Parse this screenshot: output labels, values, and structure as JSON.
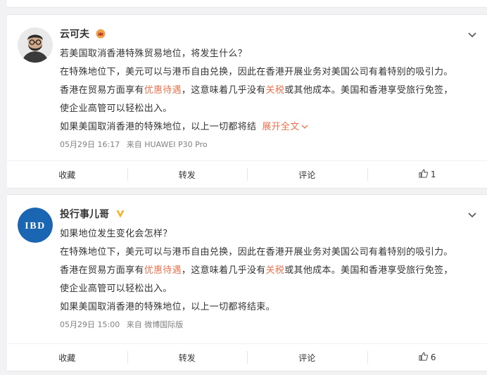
{
  "posts": [
    {
      "author": "云可夫",
      "avatar": "portrait-avatar",
      "badge": "vip-crown-icon",
      "lines": [
        {
          "parts": [
            {
              "t": "若美国取消香港特殊贸易地位，将发生什么？"
            }
          ]
        },
        {
          "parts": [
            {
              "t": "在特殊地位下，美元可以与港币自由兑换，因此在香港开展业务对美国公司有着特别的吸引力。"
            }
          ]
        },
        {
          "parts": [
            {
              "t": "香港在贸易方面享有"
            },
            {
              "t": "优惠待遇",
              "hl": true
            },
            {
              "t": "，这意味着几乎没有"
            },
            {
              "t": "关税",
              "hl": true
            },
            {
              "t": "或其他成本。美国和香港享受旅行免签，"
            }
          ]
        },
        {
          "parts": [
            {
              "t": "使企业高管可以轻松出入。"
            }
          ]
        },
        {
          "parts": [
            {
              "t": "如果美国取消香港的特殊地位，以上一切都将结"
            }
          ]
        }
      ],
      "expand_label": "展开全文",
      "date": "05月29日 16:17",
      "source": "来自 HUAWEI P30 Pro",
      "actions": {
        "fav": "收藏",
        "repost": "转发",
        "comment": "评论",
        "like_count": "1"
      }
    },
    {
      "author": "投行事儿哥",
      "avatar": "IBD",
      "badge": "verified-v-icon",
      "lines": [
        {
          "parts": [
            {
              "t": "如果地位发生变化会怎样？"
            }
          ]
        },
        {
          "parts": [
            {
              "t": "在特殊地位下，美元可以与港币自由兑换，因此在香港开展业务对美国公司有着特别的吸引力。"
            }
          ]
        },
        {
          "parts": [
            {
              "t": "香港在贸易方面享有"
            },
            {
              "t": "优惠待遇",
              "hl": true
            },
            {
              "t": "，这意味着几乎没有"
            },
            {
              "t": "关税",
              "hl": true
            },
            {
              "t": "或其他成本。美国和香港享受旅行免签，"
            }
          ]
        },
        {
          "parts": [
            {
              "t": "使企业高管可以轻松出入。"
            }
          ]
        },
        {
          "parts": [
            {
              "t": "如果美国取消香港的特殊地位，以上一切都将结束。"
            }
          ]
        }
      ],
      "date": "05月29日 15:00",
      "source": "来自 微博国际版",
      "actions": {
        "fav": "收藏",
        "repost": "转发",
        "comment": "评论",
        "like_count": "6"
      }
    }
  ],
  "colors": {
    "highlight": "#eb7350",
    "ibd_blue": "#1a66b3",
    "meta": "#808080"
  }
}
